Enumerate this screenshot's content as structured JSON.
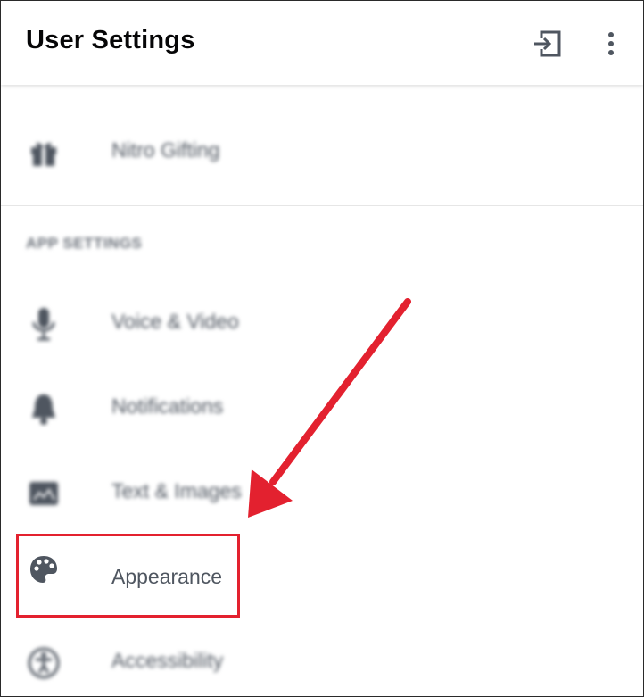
{
  "header": {
    "title": "User Settings",
    "logout_icon": "logout-icon",
    "more_icon": "more-vertical-icon"
  },
  "sections": [
    {
      "title": "",
      "items": [
        {
          "label": "Nitro Gifting",
          "icon": "gift-icon",
          "blurred": true
        }
      ]
    },
    {
      "title": "APP SETTINGS",
      "items": [
        {
          "label": "Voice & Video",
          "icon": "microphone-icon",
          "blurred": true
        },
        {
          "label": "Notifications",
          "icon": "bell-icon",
          "blurred": true
        },
        {
          "label": "Text & Images",
          "icon": "image-icon",
          "blurred": true
        },
        {
          "label": "Appearance",
          "icon": "palette-icon",
          "blurred": false,
          "highlighted": true
        },
        {
          "label": "Accessibility",
          "icon": "accessibility-icon",
          "blurred": true
        }
      ]
    }
  ],
  "annotation": {
    "type": "arrow",
    "color": "#e3212f",
    "target": "Appearance"
  }
}
